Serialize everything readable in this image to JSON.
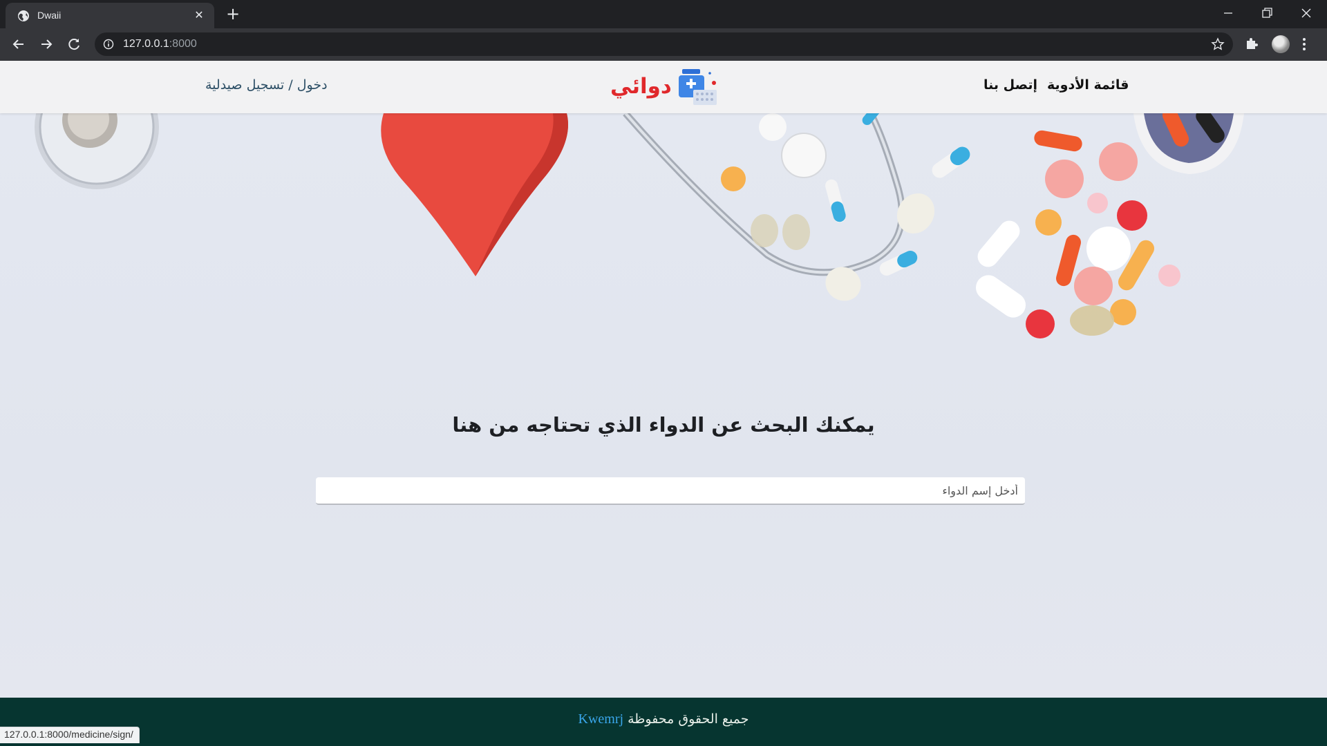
{
  "browser": {
    "tab": {
      "title": "Dwaii"
    },
    "url": {
      "host": "127.0.0.1",
      "port": ":8000"
    },
    "status_url": "127.0.0.1:8000/medicine/sign/"
  },
  "header": {
    "nav": {
      "medicine_list": "قائمة الأدوية",
      "contact": "إتصل بنا"
    },
    "brand": {
      "name": "دوائي"
    },
    "auth": {
      "login": "دخول",
      "separator": " / ",
      "register": "تسجيل صيدلية"
    }
  },
  "hero": {
    "heading": "يمكنك البحث عن الدواء الذي تحتاجه من هنا",
    "search": {
      "placeholder": "أدخل إسم الدواء",
      "value": ""
    }
  },
  "footer": {
    "text": "جميع الحقوق محفوظة",
    "brand": "Kwemrj"
  },
  "colors": {
    "brand_red": "#e0282b",
    "footer_bg": "#063530",
    "footer_link": "#3aa7ec",
    "auth_link": "#2d4f66"
  }
}
